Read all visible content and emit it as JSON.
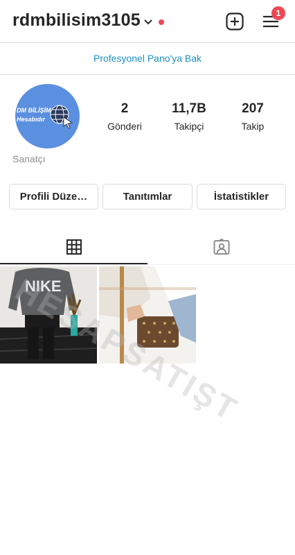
{
  "header": {
    "username": "rdmbilisim3105",
    "notification_count": "1",
    "icons": {
      "dropdown": "chevron-down-icon",
      "add": "plus-square-icon",
      "menu": "hamburger-menu-icon"
    },
    "accent_dot_color": "#ed4956"
  },
  "pro_dashboard": {
    "label": "Profesyonel Pano'ya Bak",
    "color": "#1a8fc4"
  },
  "profile": {
    "avatar_text_line1": "DM BİLİŞİM",
    "avatar_text_line2": "Hesabıdır",
    "avatar_color": "#5b8fe0",
    "category": "Sanatçı"
  },
  "stats": [
    {
      "value": "2",
      "label": "Gönderi"
    },
    {
      "value": "11,7B",
      "label": "Takipçi"
    },
    {
      "value": "207",
      "label": "Takip"
    }
  ],
  "buttons": {
    "edit_profile": "Profili Düze…",
    "promotions": "Tanıtımlar",
    "insights": "İstatistikler"
  },
  "tabs": [
    {
      "icon": "grid-icon",
      "active": true
    },
    {
      "icon": "tagged-user-icon",
      "active": false
    }
  ],
  "watermark": "HESAPSATIŞT",
  "posts": [
    {
      "image": "man-nike-sweater-photo"
    },
    {
      "image": "woman-monogram-clutch-photo"
    }
  ]
}
